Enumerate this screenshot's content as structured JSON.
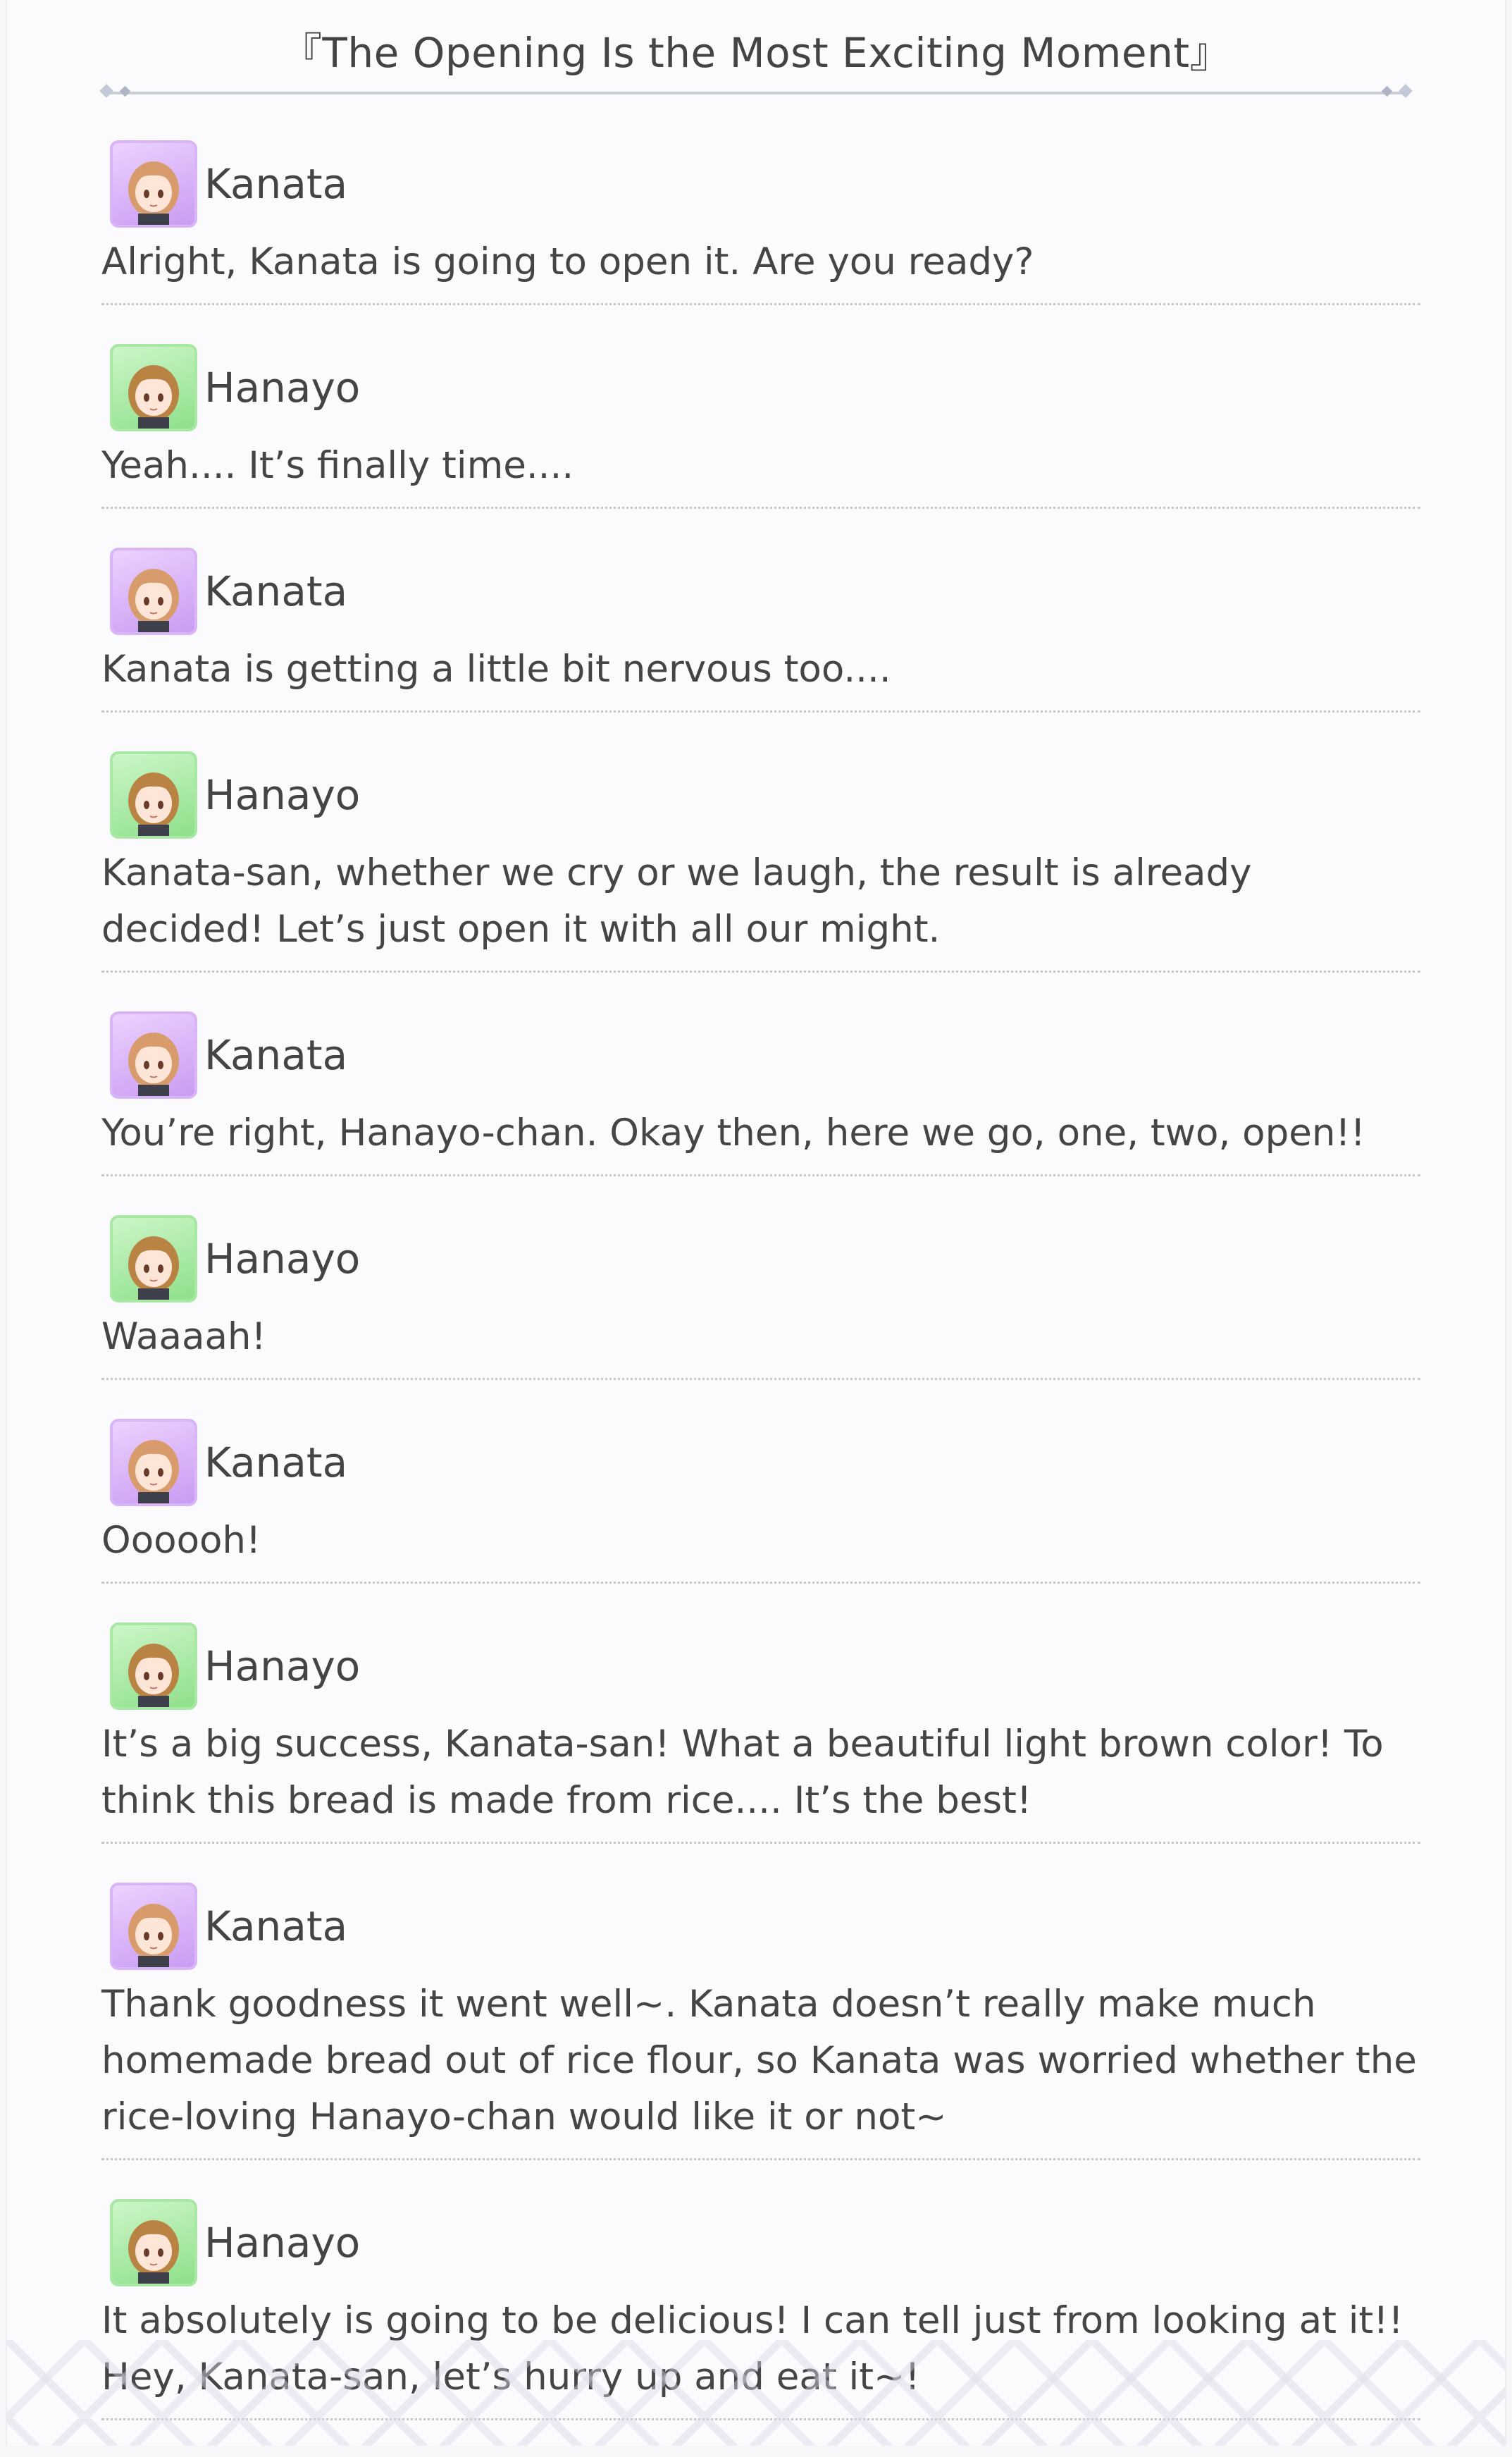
{
  "header": {
    "title": "『The Opening Is the Most Exciting Moment』"
  },
  "dialogue": [
    {
      "speaker": "Kanata",
      "avatar": "kanata-avatar",
      "text": "Alright, Kanata is going to open it. Are you ready?"
    },
    {
      "speaker": "Hanayo",
      "avatar": "hanayo-avatar",
      "text": "Yeah.... It’s finally time...."
    },
    {
      "speaker": "Kanata",
      "avatar": "kanata-avatar",
      "text": "Kanata is getting a little bit nervous too...."
    },
    {
      "speaker": "Hanayo",
      "avatar": "hanayo-avatar",
      "text": "Kanata-san, whether we cry or we laugh, the result is already decided! Let’s just open it with all our might."
    },
    {
      "speaker": "Kanata",
      "avatar": "kanata-avatar",
      "text": "You’re right, Hanayo-chan. Okay then, here we go, one, two, open!!"
    },
    {
      "speaker": "Hanayo",
      "avatar": "hanayo-avatar",
      "text": "Waaaah!"
    },
    {
      "speaker": "Kanata",
      "avatar": "kanata-avatar",
      "text": "Oooooh!"
    },
    {
      "speaker": "Hanayo",
      "avatar": "hanayo-avatar",
      "text": "It’s a big success, Kanata-san! What a beautiful light brown color! To think this bread is made from rice.... It’s the best!"
    },
    {
      "speaker": "Kanata",
      "avatar": "kanata-avatar",
      "text": "Thank goodness it went well~. Kanata doesn’t really make much homemade bread out of rice flour, so Kanata was worried whether the rice-loving Hanayo-chan would like it or not~"
    },
    {
      "speaker": "Hanayo",
      "avatar": "hanayo-avatar",
      "text": "It absolutely is going to be delicious! I can tell just from looking at it!! Hey, Kanata-san, let’s hurry up and eat it~!"
    }
  ],
  "colors": {
    "kanata_frame": "#d8b5f7",
    "hanayo_frame": "#a8e8a4",
    "text": "#454545",
    "rule": "#c9ced9"
  }
}
